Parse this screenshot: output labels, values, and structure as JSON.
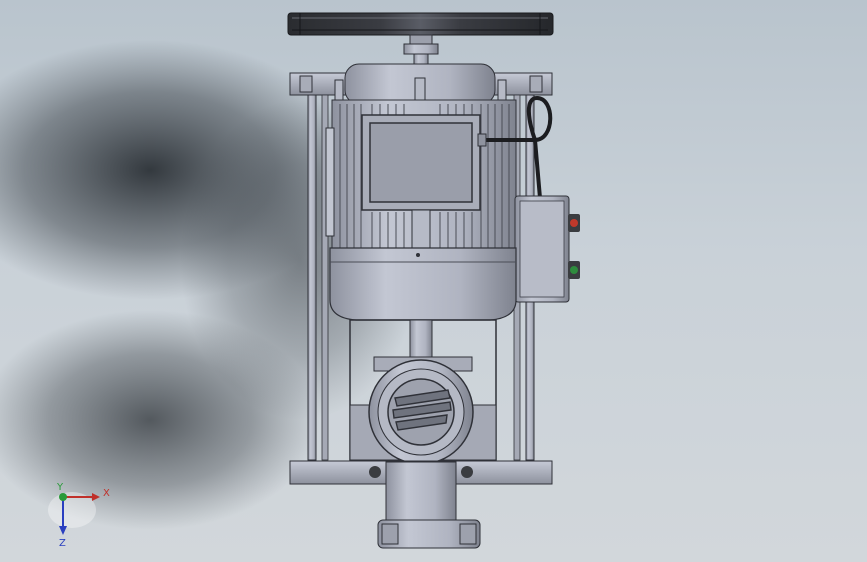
{
  "viewport": {
    "background_top": "#b9c4cd",
    "background_bottom": "#d2d7db"
  },
  "model": {
    "body_color": "#b4b8c6",
    "edge_color": "#2f3138",
    "indicator_red": "#c0392b",
    "indicator_green": "#2e8b3d"
  },
  "triad": {
    "x_label": "X",
    "y_label": "Y",
    "z_label": "Z",
    "x_color": "#c0302a",
    "y_color": "#2a9a3a",
    "z_color": "#2a3fc0"
  }
}
